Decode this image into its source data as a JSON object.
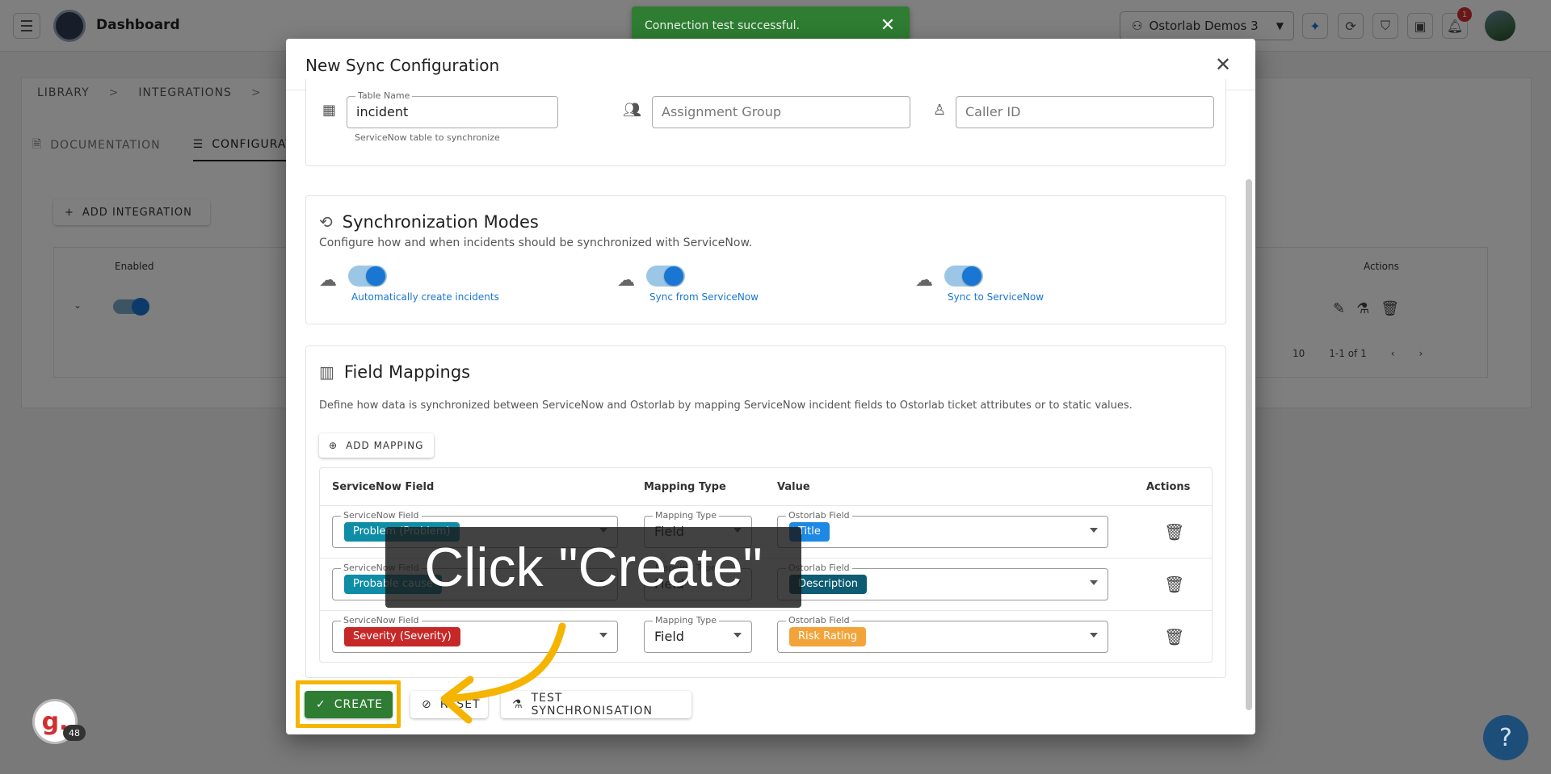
{
  "topbar": {
    "title": "Dashboard",
    "org_name": "Ostorlab Demos 3",
    "notification_count": "1",
    "icons": [
      "menu-icon",
      "sparkle-icon",
      "refresh-icon",
      "shield-icon",
      "ticket-icon",
      "bell-icon"
    ]
  },
  "background": {
    "breadcrumb": [
      "LIBRARY",
      "INTEGRATIONS"
    ],
    "tabs": [
      "DOCUMENTATION",
      "CONFIGURATION"
    ],
    "add_integration_label": "ADD INTEGRATION",
    "table_headers": {
      "enabled": "Enabled",
      "actions": "Actions"
    },
    "rows_per_page": "10",
    "page_range": "1-1 of 1"
  },
  "toast": {
    "message": "Connection test successful."
  },
  "modal": {
    "title": "New Sync Configuration",
    "table_name": {
      "label": "Table Name",
      "value": "incident",
      "helper": "ServiceNow table to synchronize"
    },
    "assignment_group_placeholder": "Assignment Group",
    "caller_id_placeholder": "Caller ID",
    "sync_modes": {
      "title": "Synchronization Modes",
      "description": "Configure how and when incidents should be synchronized with ServiceNow.",
      "modes": [
        {
          "label": "Automatically create incidents",
          "enabled": true
        },
        {
          "label": "Sync from ServiceNow",
          "enabled": true
        },
        {
          "label": "Sync to ServiceNow",
          "enabled": true
        }
      ]
    },
    "field_mappings": {
      "title": "Field Mappings",
      "description": "Define how data is synchronized between ServiceNow and Ostorlab by mapping ServiceNow incident fields to Ostorlab ticket attributes or to static values.",
      "add_mapping_label": "ADD MAPPING",
      "headers": {
        "field": "ServiceNow Field",
        "type": "Mapping Type",
        "value": "Value",
        "actions": "Actions"
      },
      "select_labels": {
        "field": "ServiceNow Field",
        "type": "Mapping Type",
        "value": "Ostorlab Field"
      },
      "rows": [
        {
          "servicenow_field": "Problem (Problem)",
          "mapping_type": "Field",
          "value": "Title"
        },
        {
          "servicenow_field": "Probable cause",
          "mapping_type": "Field",
          "value": "Description"
        },
        {
          "servicenow_field": "Severity (Severity)",
          "mapping_type": "Field",
          "value": "Risk Rating"
        }
      ]
    },
    "buttons": {
      "create": "CREATE",
      "reset": "RESET",
      "test": "TEST SYNCHRONISATION"
    }
  },
  "annotation": {
    "instruction": "Click \"Create\"",
    "highlight_color": "#f5b400"
  },
  "guide": {
    "avatar_letter": "g.",
    "count": "48"
  },
  "help_label": "?",
  "colors": {
    "primary": "#1976d2",
    "success": "#2e7d32",
    "chip_teal": "#0f8da6",
    "chip_red": "#c62828",
    "chip_orange": "#f2a43a"
  }
}
